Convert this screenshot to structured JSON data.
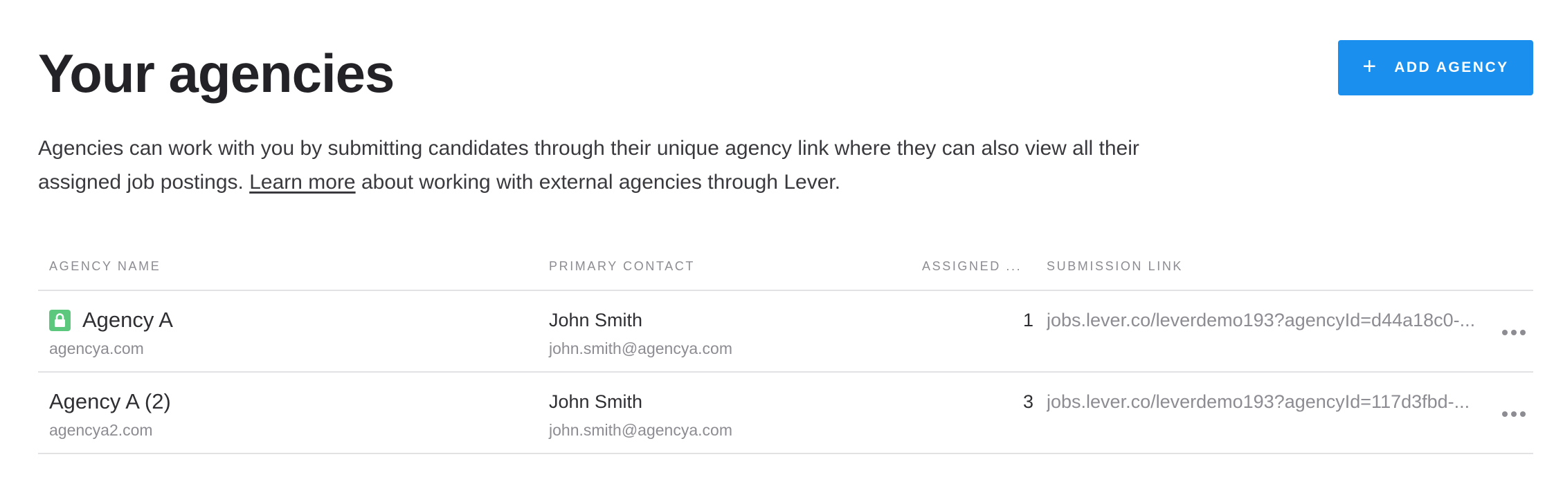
{
  "header": {
    "title": "Your agencies",
    "add_button_label": "ADD AGENCY",
    "add_button_icon": "plus-icon"
  },
  "description": {
    "text_before_link": "Agencies can work with you by submitting candidates through their unique agency link where they can also view all their assigned job postings. ",
    "link_text": "Learn more",
    "text_after_link": " about working with external agencies through Lever."
  },
  "table": {
    "columns": {
      "agency_name": "AGENCY NAME",
      "primary_contact": "PRIMARY CONTACT",
      "assigned": "ASSIGNED ...",
      "submission_link": "SUBMISSION LINK"
    },
    "rows": [
      {
        "name": "Agency A",
        "domain": "agencya.com",
        "locked": true,
        "contact_name": "John Smith",
        "contact_email": "john.smith@agencya.com",
        "assigned": "1",
        "submission_link": "jobs.lever.co/leverdemo193?agencyId=d44a18c0-..."
      },
      {
        "name": "Agency A (2)",
        "domain": "agencya2.com",
        "locked": false,
        "contact_name": "John Smith",
        "contact_email": "john.smith@agencya.com",
        "assigned": "3",
        "submission_link": "jobs.lever.co/leverdemo193?agencyId=117d3fbd-..."
      }
    ]
  },
  "colors": {
    "accent": "#1b8fee",
    "lock_badge": "#5bc87e",
    "title_text": "#232327",
    "muted_text": "#8c8c92",
    "divider": "#e2e2e4"
  }
}
